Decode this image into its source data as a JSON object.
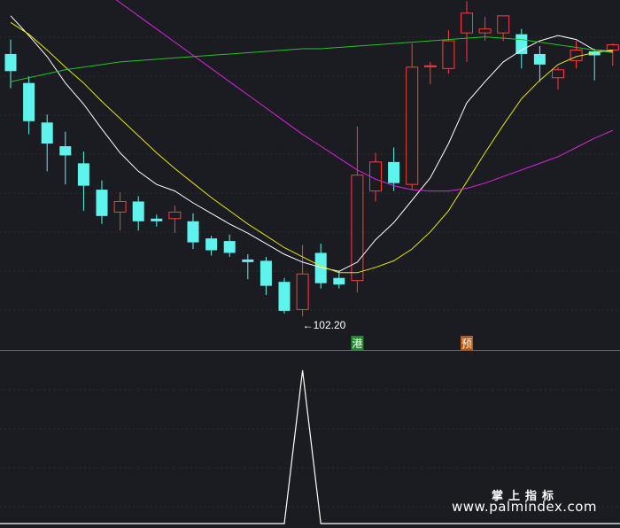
{
  "chart_data": {
    "type": "candlestick",
    "main_panel": {
      "ylim": [
        99.7,
        126.2
      ],
      "candles": [
        {
          "o": 122.1,
          "h": 123.2,
          "l": 119.5,
          "c": 120.8
        },
        {
          "o": 119.9,
          "h": 120.4,
          "l": 116.0,
          "c": 117.0
        },
        {
          "o": 116.9,
          "h": 117.5,
          "l": 113.2,
          "c": 115.3
        },
        {
          "o": 115.1,
          "h": 116.2,
          "l": 112.2,
          "c": 114.4
        },
        {
          "o": 113.8,
          "h": 114.7,
          "l": 110.2,
          "c": 112.1
        },
        {
          "o": 111.8,
          "h": 112.5,
          "l": 109.2,
          "c": 109.8
        },
        {
          "o": 110.1,
          "h": 111.6,
          "l": 108.7,
          "c": 110.9
        },
        {
          "o": 110.9,
          "h": 111.3,
          "l": 108.7,
          "c": 109.4
        },
        {
          "o": 109.6,
          "h": 109.9,
          "l": 109.0,
          "c": 109.4
        },
        {
          "o": 109.6,
          "h": 110.6,
          "l": 108.5,
          "c": 110.1
        },
        {
          "o": 109.4,
          "h": 110.0,
          "l": 107.3,
          "c": 107.8
        },
        {
          "o": 108.1,
          "h": 108.3,
          "l": 106.8,
          "c": 107.2
        },
        {
          "o": 107.9,
          "h": 108.4,
          "l": 106.7,
          "c": 107.0
        },
        {
          "o": 106.5,
          "h": 106.9,
          "l": 105.0,
          "c": 106.3
        },
        {
          "o": 106.4,
          "h": 106.7,
          "l": 103.8,
          "c": 104.5
        },
        {
          "o": 104.8,
          "h": 105.1,
          "l": 102.4,
          "c": 102.6
        },
        {
          "o": 102.7,
          "h": 107.6,
          "l": 102.2,
          "c": 105.4
        },
        {
          "o": 107.0,
          "h": 107.7,
          "l": 104.3,
          "c": 104.7
        },
        {
          "o": 105.1,
          "h": 105.6,
          "l": 104.3,
          "c": 104.6
        },
        {
          "o": 104.9,
          "h": 116.6,
          "l": 104.0,
          "c": 112.9
        },
        {
          "o": 111.7,
          "h": 114.6,
          "l": 110.9,
          "c": 113.9
        },
        {
          "o": 113.9,
          "h": 115.0,
          "l": 111.7,
          "c": 112.3
        },
        {
          "o": 112.2,
          "h": 122.9,
          "l": 111.8,
          "c": 121.1
        },
        {
          "o": 121.2,
          "h": 121.5,
          "l": 119.8,
          "c": 121.2
        },
        {
          "o": 121.0,
          "h": 123.9,
          "l": 120.6,
          "c": 123.1
        },
        {
          "o": 123.7,
          "h": 126.1,
          "l": 121.5,
          "c": 125.2
        },
        {
          "o": 123.7,
          "h": 124.9,
          "l": 123.1,
          "c": 124.0
        },
        {
          "o": 123.7,
          "h": 124.9,
          "l": 123.1,
          "c": 125.0
        },
        {
          "o": 123.6,
          "h": 124.0,
          "l": 121.0,
          "c": 122.1
        },
        {
          "o": 122.1,
          "h": 122.7,
          "l": 120.0,
          "c": 121.3
        },
        {
          "o": 120.3,
          "h": 121.1,
          "l": 119.4,
          "c": 120.9
        },
        {
          "o": 121.6,
          "h": 123.1,
          "l": 121.0,
          "c": 122.4
        },
        {
          "o": 122.3,
          "h": 122.5,
          "l": 120.1,
          "c": 122.0
        },
        {
          "o": 122.4,
          "h": 122.9,
          "l": 121.2,
          "c": 122.8
        }
      ],
      "colors": {
        "up": "#ff3b3b",
        "down": "#5ff3ee",
        "background": "#1b1c22",
        "grid": "#2c2e36",
        "separator": "#6a6c74"
      },
      "moving_averages": [
        {
          "color": "#ffffff",
          "values": [
            125.0,
            123.5,
            121.9,
            119.9,
            118.3,
            116.4,
            114.6,
            113.2,
            112.2,
            111.7,
            110.8,
            110.0,
            109.2,
            108.5,
            107.7,
            106.9,
            106.3,
            105.9,
            105.6,
            106.3,
            108.0,
            109.3,
            111.0,
            112.7,
            115.3,
            118.4,
            120.0,
            121.5,
            122.4,
            123.1,
            123.5,
            123.2,
            122.4,
            122.3
          ]
        },
        {
          "color": "#e6e600",
          "values": [
            124.5,
            123.6,
            122.4,
            121.1,
            119.9,
            118.5,
            117.2,
            115.9,
            114.6,
            113.4,
            112.3,
            111.2,
            110.2,
            109.2,
            108.3,
            107.4,
            106.7,
            106.0,
            105.5,
            105.5,
            105.9,
            106.4,
            107.3,
            108.6,
            110.2,
            112.4,
            114.6,
            116.7,
            118.7,
            120.1,
            121.3,
            121.9,
            122.2,
            122.4
          ]
        },
        {
          "color": "#dd22dd",
          "values": [
            132.0,
            131.0,
            130.0,
            129.0,
            128.0,
            127.0,
            126.0,
            125.0,
            124.0,
            123.0,
            122.0,
            121.0,
            120.0,
            119.0,
            118.0,
            117.0,
            116.0,
            115.1,
            114.2,
            113.3,
            112.6,
            112.1,
            111.8,
            111.7,
            111.7,
            111.9,
            112.3,
            112.8,
            113.3,
            113.8,
            114.3,
            115.0,
            115.7,
            116.3
          ]
        },
        {
          "color": "#22c422",
          "values": [
            120.0,
            120.3,
            120.6,
            120.9,
            121.1,
            121.3,
            121.5,
            121.6,
            121.7,
            121.8,
            121.9,
            122.0,
            122.1,
            122.2,
            122.3,
            122.4,
            122.5,
            122.5,
            122.6,
            122.7,
            122.8,
            122.9,
            123.0,
            123.1,
            123.2,
            123.3,
            123.4,
            123.3,
            123.2,
            123.0,
            122.8,
            122.6,
            122.4,
            122.2
          ]
        }
      ],
      "annotations": [
        {
          "text": "←102.20",
          "candle": 16,
          "value": 102.2
        }
      ],
      "markers": [
        {
          "text": "港",
          "candle": 19,
          "color": "#1f8a2a"
        },
        {
          "text": "预",
          "candle": 25,
          "color": "#b85a17"
        }
      ]
    },
    "sub_panel": {
      "type": "line",
      "color": "#ffffff",
      "ylim": [
        0,
        1
      ],
      "values": [
        0,
        0,
        0,
        0,
        0,
        0,
        0,
        0,
        0,
        0,
        0,
        0,
        0,
        0,
        0,
        0,
        1,
        0,
        0,
        0,
        0,
        0,
        0,
        0,
        0,
        0,
        0,
        0,
        0,
        0,
        0,
        0,
        0,
        0
      ]
    }
  },
  "watermark": {
    "brand_cn": "掌上指标",
    "url": "www.palmindex.com"
  }
}
